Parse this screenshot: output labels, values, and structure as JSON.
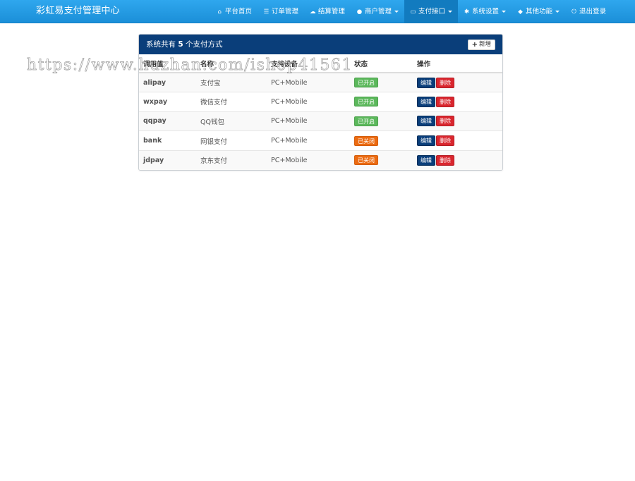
{
  "navbar": {
    "brand": "彩虹易支付管理中心",
    "items": [
      {
        "icon": "home-icon",
        "glyph": "⌂",
        "label": "平台首页",
        "dropdown": false,
        "active": false
      },
      {
        "icon": "list-icon",
        "glyph": "☰",
        "label": "订单管理",
        "dropdown": false,
        "active": false
      },
      {
        "icon": "cloud-icon",
        "glyph": "☁",
        "label": "结算管理",
        "dropdown": false,
        "active": false
      },
      {
        "icon": "user-icon",
        "glyph": "●",
        "label": "商户管理",
        "dropdown": true,
        "active": false
      },
      {
        "icon": "credit-card-icon",
        "glyph": "▭",
        "label": "支付接口",
        "dropdown": true,
        "active": true
      },
      {
        "icon": "gear-icon",
        "glyph": "✱",
        "label": "系统设置",
        "dropdown": true,
        "active": false
      },
      {
        "icon": "cube-icon",
        "glyph": "◆",
        "label": "其他功能",
        "dropdown": true,
        "active": false
      },
      {
        "icon": "power-icon",
        "glyph": "⏻",
        "label": "退出登录",
        "dropdown": false,
        "active": false
      }
    ]
  },
  "panel": {
    "title_prefix": "系统共有 ",
    "count": "5",
    "title_suffix": " 个支付方式",
    "add_label": "新增"
  },
  "table": {
    "headers": [
      "调用值",
      "名称",
      "支持设备",
      "状态",
      "操作"
    ],
    "rows": [
      {
        "code": "alipay",
        "name": "支付宝",
        "device": "PC+Mobile",
        "status": "已开启",
        "enabled": true
      },
      {
        "code": "wxpay",
        "name": "微信支付",
        "device": "PC+Mobile",
        "status": "已开启",
        "enabled": true
      },
      {
        "code": "qqpay",
        "name": "QQ钱包",
        "device": "PC+Mobile",
        "status": "已开启",
        "enabled": true
      },
      {
        "code": "bank",
        "name": "网银支付",
        "device": "PC+Mobile",
        "status": "已关闭",
        "enabled": false
      },
      {
        "code": "jdpay",
        "name": "京东支付",
        "device": "PC+Mobile",
        "status": "已关闭",
        "enabled": false
      }
    ],
    "edit_label": "编辑",
    "delete_label": "删除"
  },
  "colors": {
    "navbar": "#1b8fd8",
    "panel_heading": "#0a3e7a",
    "status_on": "#5cb85c",
    "status_off": "#ec6b11",
    "delete": "#d9262e"
  },
  "watermark": "https://www.huzhan.com/ishop41561"
}
